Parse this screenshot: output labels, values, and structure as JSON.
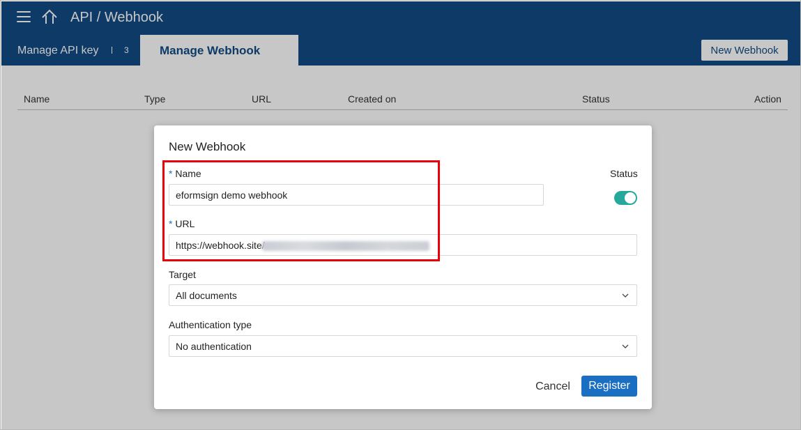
{
  "header": {
    "title": "API / Webhook"
  },
  "tabs": {
    "api_key": {
      "label": "Manage API key",
      "count": "3"
    },
    "webhook": {
      "label": "Manage Webhook"
    }
  },
  "toolbar": {
    "new_webhook_label": "New Webhook"
  },
  "table": {
    "columns": [
      "Name",
      "Type",
      "URL",
      "Created on",
      "Status",
      "Action"
    ]
  },
  "modal": {
    "title": "New Webhook",
    "required_mark": "*",
    "name": {
      "label": "Name",
      "value": "eformsign demo webhook"
    },
    "url": {
      "label": "URL",
      "value": "https://webhook.site/"
    },
    "status": {
      "label": "Status",
      "enabled": true
    },
    "target": {
      "label": "Target",
      "selected": "All documents"
    },
    "auth": {
      "label": "Authentication type",
      "selected": "No authentication"
    },
    "cancel_label": "Cancel",
    "register_label": "Register"
  },
  "colors": {
    "brand": "#114b85",
    "accent": "#1b6fc2",
    "toggle_on": "#26a99a",
    "highlight": "#e8000b"
  }
}
